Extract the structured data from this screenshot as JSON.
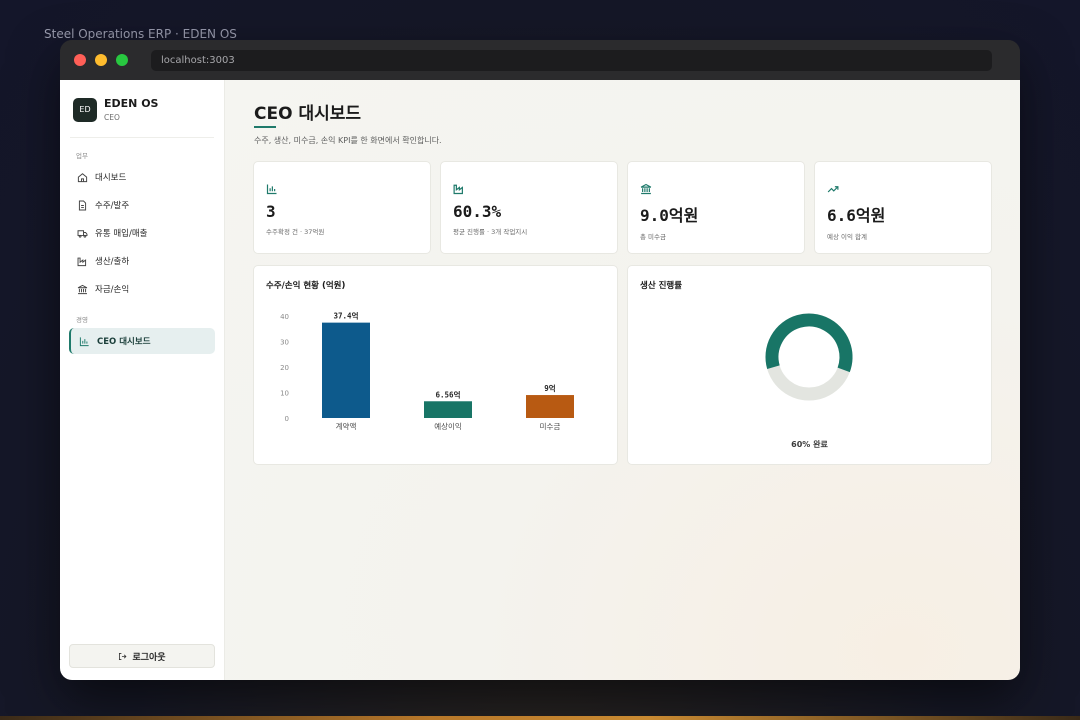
{
  "outer_title": "Steel Operations ERP · EDEN OS",
  "browser": {
    "url": "localhost:3003"
  },
  "brand": {
    "logo_text": "ED",
    "name": "EDEN OS",
    "role": "CEO"
  },
  "sidebar": {
    "sections": [
      {
        "label": "업무"
      },
      {
        "label": "경영"
      }
    ],
    "items": [
      {
        "label": "대시보드",
        "icon": "home-icon"
      },
      {
        "label": "수주/발주",
        "icon": "document-icon"
      },
      {
        "label": "유통 매입/매출",
        "icon": "truck-icon"
      },
      {
        "label": "생산/출하",
        "icon": "factory-icon"
      },
      {
        "label": "자금/손익",
        "icon": "bank-icon"
      },
      {
        "label": "CEO 대시보드",
        "icon": "bar-chart-icon",
        "active": true
      }
    ],
    "logout_label": "로그아웃"
  },
  "page": {
    "title": "CEO 대시보드",
    "subtitle": "수주, 생산, 미수금, 손익 KPI를 한 화면에서 확인합니다."
  },
  "kpis": [
    {
      "icon": "bar-chart-icon",
      "value": "3",
      "label": "수주확정 건 · 37억원"
    },
    {
      "icon": "factory-icon",
      "value": "60.3%",
      "label": "평균 진행률 · 3개 작업지시"
    },
    {
      "icon": "bank-icon",
      "value": "9.0억원",
      "label": "총 미수금"
    },
    {
      "icon": "trending-up-icon",
      "value": "6.6억원",
      "label": "예상 이익 합계"
    }
  ],
  "bar_card": {
    "title": "수주/손익 현황 (억원)"
  },
  "donut_card": {
    "title": "생산 진행률",
    "center_label": "60% 완료"
  },
  "colors": {
    "accent": "#1f7a6b",
    "blue": "#0d5a8c",
    "teal": "#187566",
    "orange": "#b85a12",
    "donut_track": "#e3e5e0"
  },
  "chart_data": [
    {
      "type": "bar",
      "title": "수주/손익 현황 (억원)",
      "categories": [
        "계약액",
        "예상이익",
        "미수금"
      ],
      "values": [
        37.4,
        6.56,
        9
      ],
      "value_labels": [
        "37.4억",
        "6.56억",
        "9억"
      ],
      "colors": [
        "#0d5a8c",
        "#187566",
        "#b85a12"
      ],
      "yticks": [
        "0",
        "10",
        "20",
        "30",
        "40"
      ],
      "ylim": [
        0,
        40
      ],
      "grid": false
    },
    {
      "type": "pie",
      "title": "생산 진행률",
      "values": [
        60,
        40
      ],
      "colors": [
        "#187566",
        "#e3e5e0"
      ],
      "center_label": "60% 완료"
    }
  ]
}
